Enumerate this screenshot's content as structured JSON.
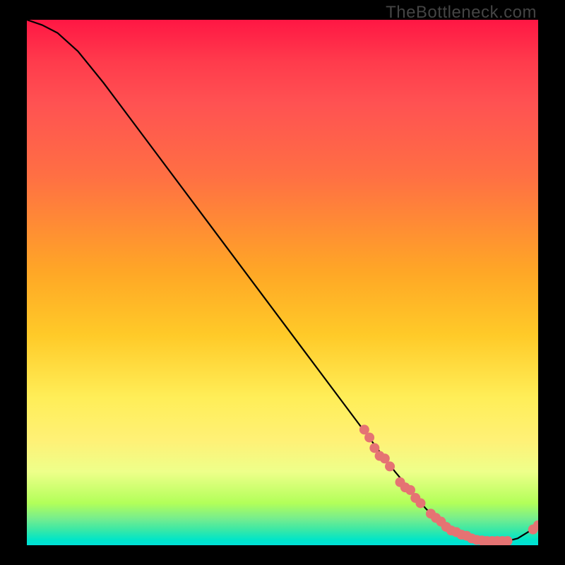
{
  "watermark": "TheBottleneck.com",
  "chart_data": {
    "type": "line",
    "title": "",
    "xlabel": "",
    "ylabel": "",
    "xlim": [
      0,
      100
    ],
    "ylim": [
      0,
      100
    ],
    "grid": false,
    "legend": false,
    "series": [
      {
        "name": "bottleneck-curve",
        "color": "#000000",
        "x": [
          0,
          3,
          6,
          10,
          15,
          20,
          25,
          30,
          35,
          40,
          45,
          50,
          55,
          60,
          65,
          70,
          72,
          75,
          78,
          80,
          82,
          84,
          86,
          88,
          90,
          92,
          94,
          96,
          98,
          100
        ],
        "y": [
          100,
          99,
          97.5,
          94,
          88,
          81.5,
          75,
          68.5,
          62,
          55.5,
          49,
          42.5,
          36,
          29.5,
          23,
          16.5,
          14,
          10.5,
          7,
          5,
          3.5,
          2.5,
          1.8,
          1,
          0.8,
          0.8,
          0.8,
          1.3,
          2.5,
          3.8
        ]
      }
    ],
    "markers": [
      {
        "name": "data-points",
        "shape": "circle",
        "color": "#e57373",
        "radius": 7,
        "points": [
          {
            "x": 66,
            "y": 22
          },
          {
            "x": 67,
            "y": 20.5
          },
          {
            "x": 68,
            "y": 18.5
          },
          {
            "x": 69,
            "y": 17
          },
          {
            "x": 70,
            "y": 16.5
          },
          {
            "x": 71,
            "y": 15
          },
          {
            "x": 73,
            "y": 12
          },
          {
            "x": 74,
            "y": 11
          },
          {
            "x": 75,
            "y": 10.5
          },
          {
            "x": 76,
            "y": 9
          },
          {
            "x": 77,
            "y": 8
          },
          {
            "x": 79,
            "y": 6
          },
          {
            "x": 80,
            "y": 5.2
          },
          {
            "x": 81,
            "y": 4.5
          },
          {
            "x": 82,
            "y": 3.5
          },
          {
            "x": 83,
            "y": 2.8
          },
          {
            "x": 84,
            "y": 2.5
          },
          {
            "x": 85,
            "y": 2
          },
          {
            "x": 86,
            "y": 1.8
          },
          {
            "x": 87,
            "y": 1.3
          },
          {
            "x": 88,
            "y": 1
          },
          {
            "x": 89,
            "y": 0.9
          },
          {
            "x": 90,
            "y": 0.8
          },
          {
            "x": 91,
            "y": 0.8
          },
          {
            "x": 92,
            "y": 0.8
          },
          {
            "x": 93,
            "y": 0.8
          },
          {
            "x": 94,
            "y": 0.8
          },
          {
            "x": 99,
            "y": 3
          },
          {
            "x": 100,
            "y": 3.8
          }
        ]
      }
    ],
    "background_gradient": {
      "type": "vertical",
      "stops": [
        {
          "pos": 0,
          "color": "#ff1744"
        },
        {
          "pos": 30,
          "color": "#ff7043"
        },
        {
          "pos": 60,
          "color": "#ffca28"
        },
        {
          "pos": 80,
          "color": "#fff176"
        },
        {
          "pos": 95,
          "color": "#74ed8f"
        },
        {
          "pos": 100,
          "color": "#00e0d8"
        }
      ]
    }
  }
}
